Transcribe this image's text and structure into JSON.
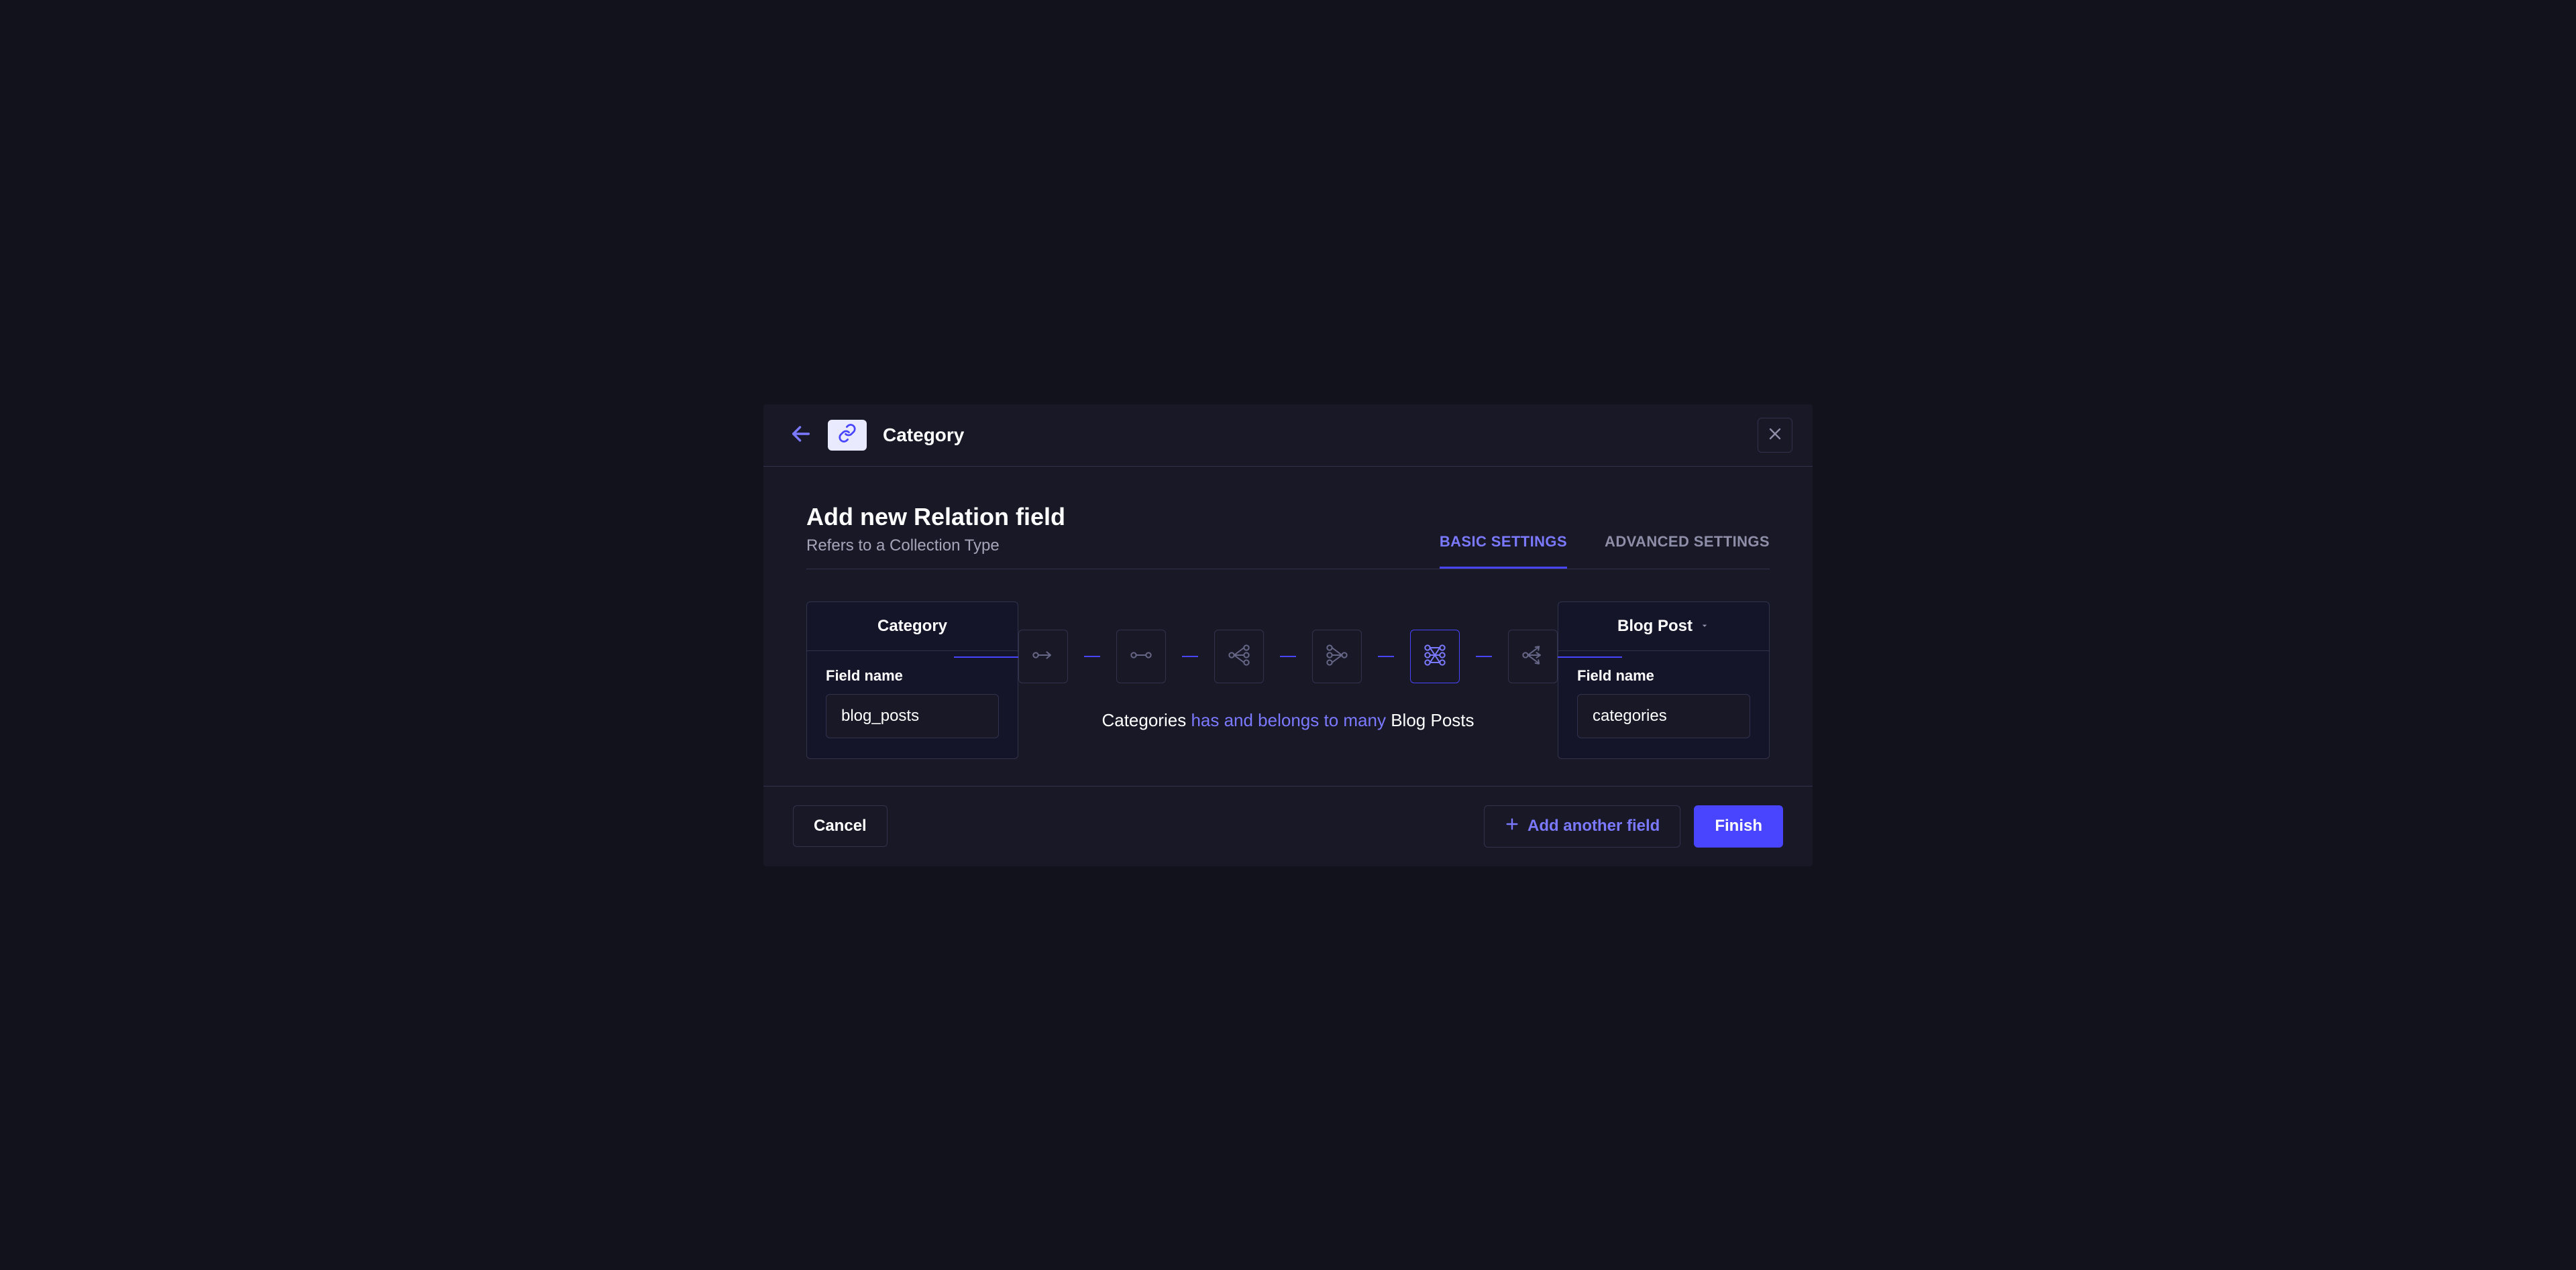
{
  "header": {
    "title": "Category"
  },
  "section": {
    "title": "Add new Relation field",
    "subtitle": "Refers to a Collection Type"
  },
  "tabs": {
    "basic": "BASIC SETTINGS",
    "advanced": "ADVANCED SETTINGS"
  },
  "left": {
    "title": "Category",
    "field_label": "Field name",
    "field_value": "blog_posts"
  },
  "right": {
    "title": "Blog Post",
    "field_label": "Field name",
    "field_value": "categories"
  },
  "relation_sentence": {
    "left": "Categories",
    "mid": "has and belongs to many",
    "right": "Blog Posts"
  },
  "footer": {
    "cancel": "Cancel",
    "add_another": "Add another field",
    "finish": "Finish"
  }
}
